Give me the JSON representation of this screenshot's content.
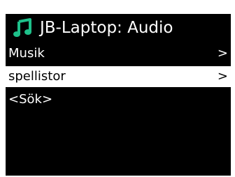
{
  "header": {
    "icon": "music-note-icon",
    "title": "JB-Laptop: Audio"
  },
  "menu": {
    "items": [
      {
        "label": "Musik",
        "arrow": ">",
        "selected": false
      },
      {
        "label": "spellistor",
        "arrow": ">",
        "selected": true
      },
      {
        "label": "<Sök>",
        "arrow": "",
        "selected": false
      }
    ]
  },
  "colors": {
    "background": "#000000",
    "text": "#ffffff",
    "accent": "#1ec08a",
    "selection_bg": "#ffffff",
    "selection_text": "#000000"
  }
}
